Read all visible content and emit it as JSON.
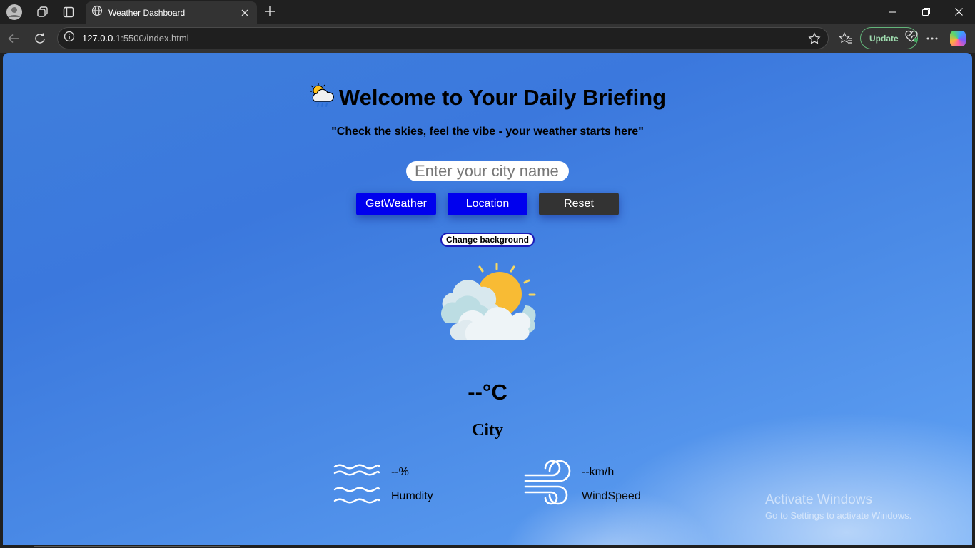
{
  "browser": {
    "tab_title": "Weather Dashboard",
    "url_host": "127.0.0.1",
    "url_rest": ":5500/index.html",
    "update_label": "Update"
  },
  "page": {
    "title": "Welcome to Your Daily Briefing",
    "title_emoji": "🌦️",
    "tagline": "\"Check the skies, feel the vibe - your weather starts here\"",
    "search_placeholder": "Enter your city name",
    "buttons": {
      "get_weather": "GetWeather",
      "location": "Location",
      "reset": "Reset",
      "change_background": "Change background"
    },
    "temperature": "--°C",
    "city": "City",
    "humidity": {
      "value": "--%",
      "label": "Humdity"
    },
    "wind": {
      "value": "--km/h",
      "label": "WindSpeed"
    }
  },
  "watermark": {
    "title": "Activate Windows",
    "subtitle": "Go to Settings to activate Windows."
  },
  "colors": {
    "primary_button": "#0000ee",
    "reset_button": "#333333",
    "sky_top": "#3b78dd",
    "sky_bottom": "#62a4f5"
  }
}
